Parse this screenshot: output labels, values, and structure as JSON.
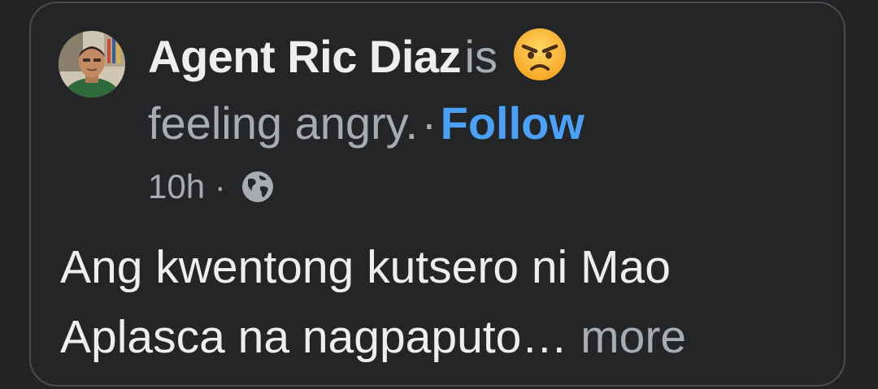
{
  "post": {
    "author_name": "Agent Ric Diaz",
    "status_prefix": "is",
    "feeling_emoji_icon": "angry-face-icon",
    "feeling_text": "feeling angry.",
    "separator": "·",
    "follow_label": "Follow",
    "timestamp": "10h",
    "audience_icon": "globe-icon",
    "body_line_1": "Ang kwentong kutsero ni Mao",
    "body_line_2": "Aplasca na nagpaputo…",
    "more_label": "more"
  },
  "colors": {
    "background": "#222325",
    "card": "#242527",
    "card_border": "#4a4c50",
    "primary_text": "#eceef0",
    "secondary_text": "#a8abb0",
    "link": "#4aa1f7"
  }
}
